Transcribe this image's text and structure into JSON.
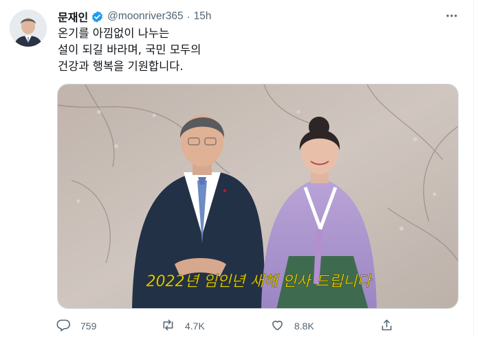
{
  "tweet": {
    "author_name": "문재인",
    "handle": "@moonriver365",
    "separator": "·",
    "time": "15h",
    "text_lines": [
      "온기를 아낌없이 나누는",
      "설이 되길 바라며, 국민 모두의",
      "건강과 행복을 기원합니다."
    ],
    "media_caption": "2022년 임인년 새해 인사 드립니다",
    "stats": {
      "replies": "759",
      "retweets": "4.7K",
      "likes": "8.8K"
    }
  },
  "icons": {
    "verified": "verified-badge-icon",
    "more": "more-icon",
    "reply": "reply-icon",
    "retweet": "retweet-icon",
    "like": "heart-icon",
    "share": "share-icon"
  },
  "colors": {
    "verified": "#1d9bf0",
    "secondary_text": "#536471",
    "caption": "#f3e600"
  }
}
